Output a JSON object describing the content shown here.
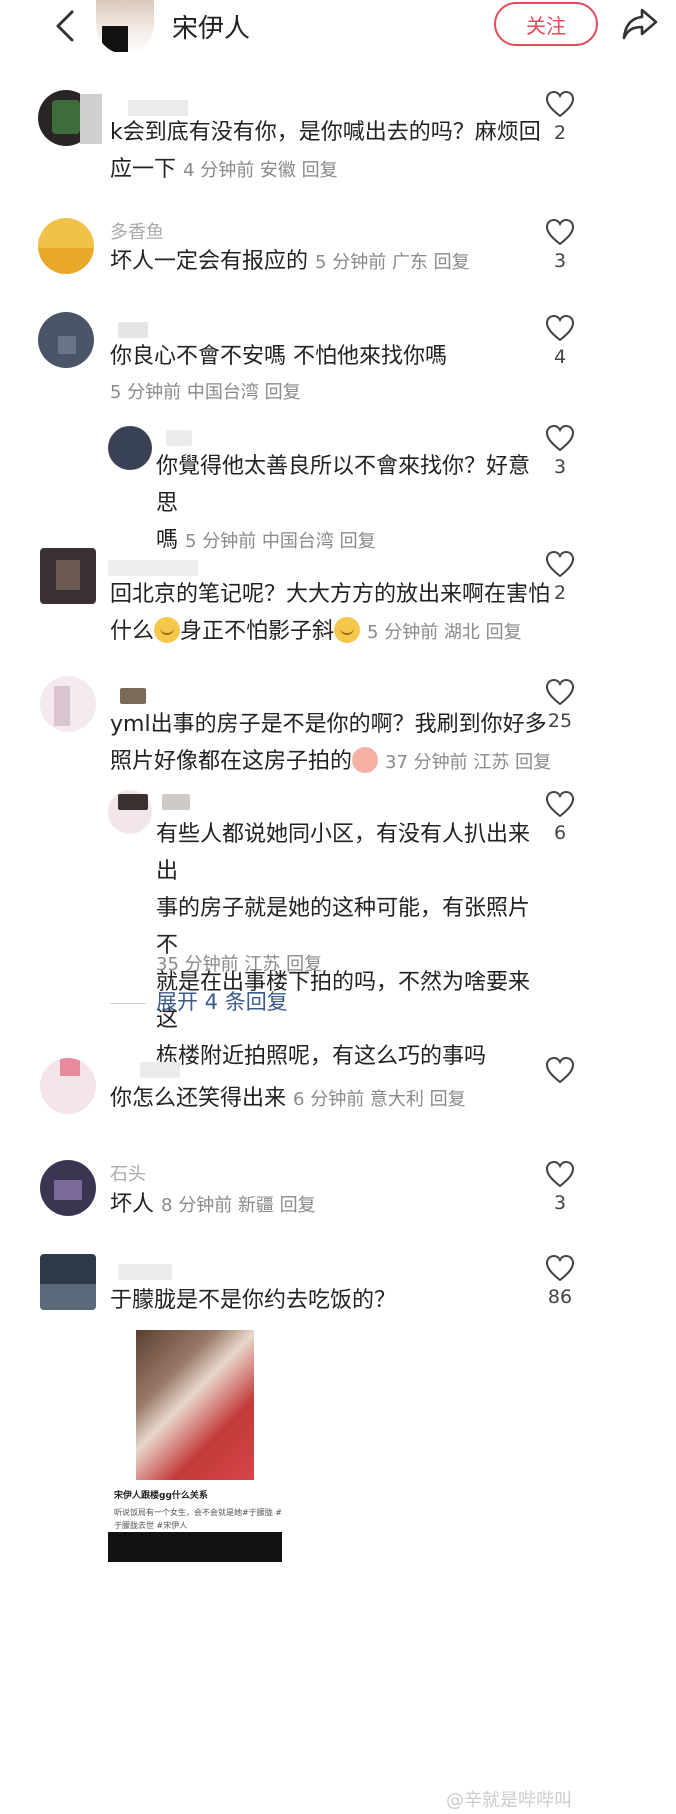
{
  "header": {
    "author_name": "宋伊人",
    "follow_label": "关注"
  },
  "comments": [
    {
      "text_line1": "k会到底有没有你，是你喊出去的吗？麻烦回",
      "text_line2": "应一下",
      "meta": "4 分钟前  安徽  回复",
      "likes": "2"
    },
    {
      "name": "多香鱼",
      "text": "坏人一定会有报应的",
      "meta": "5 分钟前  广东  回复",
      "likes": "3"
    },
    {
      "text": "你良心不會不安嗎 不怕他來找你嗎",
      "meta": "5 分钟前  中国台湾  回复",
      "likes": "4"
    },
    {
      "reply": true,
      "text_line1": "你覺得他太善良所以不會來找你？好意思",
      "text_line2": "嗎",
      "meta": "5 分钟前  中国台湾  回复",
      "likes": "3"
    },
    {
      "text_line1": "回北京的笔记呢？大大方方的放出来啊在害怕",
      "text_line2_pre": "什么",
      "text_line2_mid": "身正不怕影子斜",
      "meta": "5 分钟前  湖北  回复",
      "likes": "2"
    },
    {
      "text_line1": "yml出事的房子是不是你的啊？我刷到你好多",
      "text_line2": "照片好像都在这房子拍的",
      "meta": "37 分钟前  江苏  回复",
      "likes": "25"
    },
    {
      "reply": true,
      "text_line1": "有些人都说她同小区，有没有人扒出来出",
      "text_line2": "事的房子就是她的这种可能，有张照片不",
      "text_line3": "就是在出事楼下拍的吗，不然为啥要来这",
      "text_line4": "栋楼附近拍照呢，有这么巧的事吗",
      "meta": "35 分钟前  江苏  回复",
      "likes": "6"
    },
    {
      "text": "你怎么还笑得出来",
      "meta": "6 分钟前  意大利  回复",
      "likes": ""
    },
    {
      "name": "石头",
      "text": "坏人",
      "meta": "8 分钟前  新疆  回复",
      "likes": "3"
    },
    {
      "text": "于朦胧是不是你约去吃饭的？",
      "likes": "86"
    }
  ],
  "expand_label": "展开 4 条回复",
  "post_image": {
    "caption": "宋伊人跟楼gg什么关系",
    "sub1": "听说饭局有一个女生，会不会就是她#于朦胧 #",
    "sub2": "于朦胧去世 #宋伊人"
  },
  "watermark": "@辛就是哔哔叫"
}
